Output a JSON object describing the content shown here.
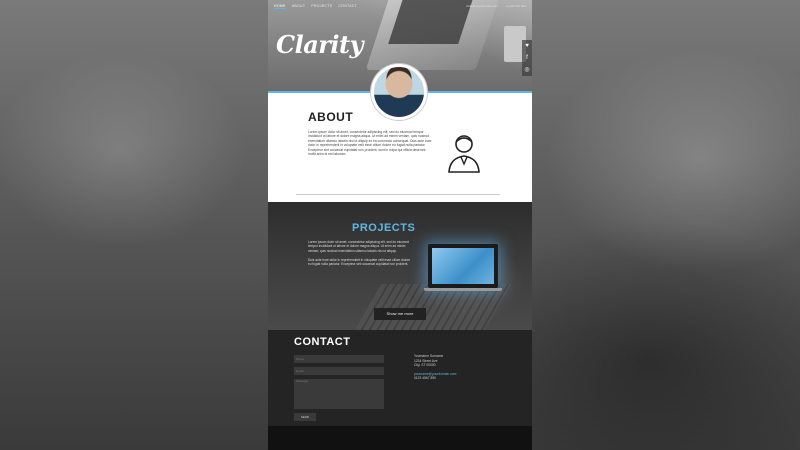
{
  "site": {
    "logo": "Clarity"
  },
  "nav": {
    "items": [
      "HOME",
      "ABOUT",
      "PROJECTS",
      "CONTACT"
    ],
    "contact_email": "hello@yourdomain.com",
    "contact_phone": "+1 234 567 890"
  },
  "about": {
    "title": "ABOUT",
    "text": "Lorem ipsum dolor sit amet, consectetur adipiscing elit, sed do eiusmod tempor incididunt ut labore et dolore magna aliqua. Ut enim ad minim veniam, quis nostrud exercitation ullamco laboris nisi ut aliquip ex ea commodo consequat. Duis aute irure dolor in reprehenderit in voluptate velit esse cillum dolore eu fugiat nulla pariatur. Excepteur sint occaecat cupidatat non proident, sunt in culpa qui officia deserunt mollit anim id est laborum."
  },
  "projects": {
    "title": "PROJECTS",
    "paragraphs": [
      "Lorem ipsum dolor sit amet, consectetur adipiscing elit, sed do eiusmod tempor incididunt ut labore et dolore magna aliqua. Ut enim ad minim veniam, quis nostrud exercitation ullamco laboris nisi ut aliquip.",
      "Duis aute irure dolor in reprehenderit in voluptate velit esse cillum dolore eu fugiat nulla pariatur. Excepteur sint occaecat cupidatat non proident."
    ],
    "button": "Show me more"
  },
  "contact": {
    "title": "CONTACT",
    "placeholder_name": "Name",
    "placeholder_email": "Email",
    "placeholder_message": "Message",
    "send": "SEND",
    "address_name": "Yourname Surname",
    "address_street": "1234 Street Ave",
    "address_city": "City, ST 00000",
    "email": "yourname@yourdomain.com",
    "phone": "0123 4567 890"
  },
  "colors": {
    "accent": "#5fb6e6",
    "dark": "#242424"
  }
}
